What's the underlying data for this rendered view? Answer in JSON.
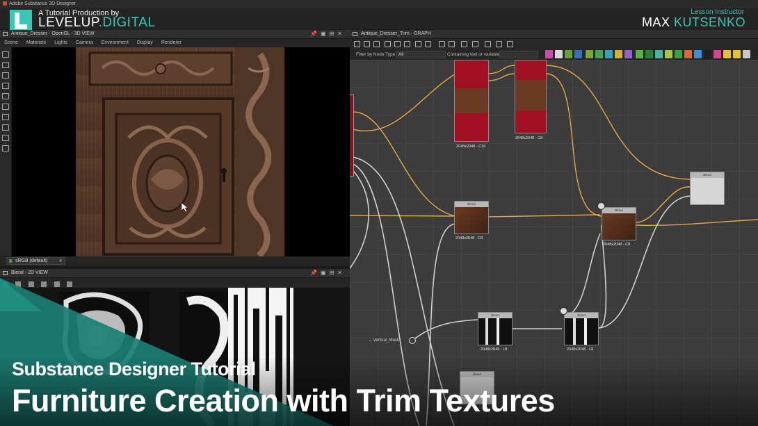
{
  "os_title": "Adobe Substance 3D Designer",
  "branding": {
    "tagline": "A Tutorial Production by",
    "brand_main": "LEVELUP",
    "brand_accent": ".DIGITAL",
    "accent_color": "#3ac7b5",
    "logo_icon": "levelup-logo-icon"
  },
  "instructor": {
    "label": "Lesson Instructor",
    "first_name": "MAX",
    "last_name": "KUTSENKO"
  },
  "view3d": {
    "title": "Antique_Dresser - OpenGL - 3D VIEW",
    "menu": [
      "Scene",
      "Materials",
      "Lights",
      "Camera",
      "Environment",
      "Display",
      "Renderer"
    ],
    "colorspace": "sRGB (default)"
  },
  "view2d": {
    "title": "Blend - 2D VIEW"
  },
  "graph": {
    "title": "Antique_Dresser_Trim - GRAPH",
    "filter_label": "Filter by Node Type",
    "filter_value": "All",
    "contains_label": "Containing text or variable",
    "input_node_label": "Vertical_Mask",
    "nodes": [
      {
        "id": "n1",
        "res": "2048x2048 - C16",
        "title": ""
      },
      {
        "id": "n2",
        "res": "2048x2048 - C8",
        "title": ""
      },
      {
        "id": "n3",
        "res": "2048x2048 - C8",
        "title": "Blend"
      },
      {
        "id": "n4",
        "res": "2048x2048 - C8",
        "title": "Blend"
      },
      {
        "id": "n5",
        "res": "",
        "title": "Blend"
      },
      {
        "id": "n6",
        "res": "2048x2048 - L8",
        "title": "Blend"
      },
      {
        "id": "n7",
        "res": "2048x2048 - L8",
        "title": "Blend"
      },
      {
        "id": "n8",
        "res": "",
        "title": "Blend"
      }
    ],
    "wire_color_orange": "#e8a640",
    "wire_color_gray": "#d0d0d0"
  },
  "overlay": {
    "subtitle": "Substance Designer Tutorial",
    "title": "Furniture Creation with Trim Textures",
    "teal_color": "#1b7f75"
  }
}
